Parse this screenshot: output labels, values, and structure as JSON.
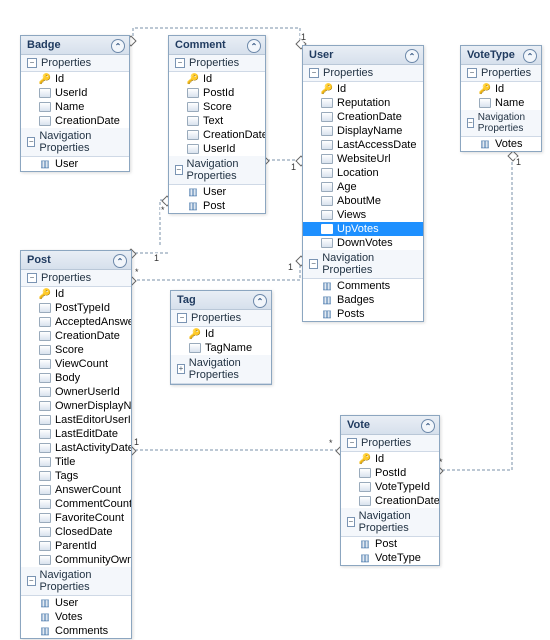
{
  "entities": {
    "badge": {
      "title": "Badge",
      "properties": [
        "Id",
        "UserId",
        "Name",
        "CreationDate"
      ],
      "keys": [
        "Id"
      ],
      "nav": [
        "User"
      ]
    },
    "comment": {
      "title": "Comment",
      "properties": [
        "Id",
        "PostId",
        "Score",
        "Text",
        "CreationDate",
        "UserId"
      ],
      "keys": [
        "Id"
      ],
      "nav": [
        "User",
        "Post"
      ]
    },
    "user": {
      "title": "User",
      "properties": [
        "Id",
        "Reputation",
        "CreationDate",
        "DisplayName",
        "LastAccessDate",
        "WebsiteUrl",
        "Location",
        "Age",
        "AboutMe",
        "Views",
        "UpVotes",
        "DownVotes"
      ],
      "keys": [
        "Id"
      ],
      "selected": "UpVotes",
      "nav": [
        "Comments",
        "Badges",
        "Posts"
      ]
    },
    "votetype": {
      "title": "VoteType",
      "properties": [
        "Id",
        "Name"
      ],
      "keys": [
        "Id"
      ],
      "nav": [
        "Votes"
      ]
    },
    "post": {
      "title": "Post",
      "properties": [
        "Id",
        "PostTypeId",
        "AcceptedAnswe...",
        "CreationDate",
        "Score",
        "ViewCount",
        "Body",
        "OwnerUserId",
        "OwnerDisplayN...",
        "LastEditorUserId",
        "LastEditDate",
        "LastActivityDate",
        "Title",
        "Tags",
        "AnswerCount",
        "CommentCount",
        "FavoriteCount",
        "ClosedDate",
        "ParentId",
        "CommunityOwn..."
      ],
      "keys": [
        "Id"
      ],
      "nav": [
        "User",
        "Votes",
        "Comments"
      ]
    },
    "tag": {
      "title": "Tag",
      "properties": [
        "Id",
        "TagName"
      ],
      "keys": [
        "Id"
      ],
      "nav": []
    },
    "vote": {
      "title": "Vote",
      "properties": [
        "Id",
        "PostId",
        "VoteTypeId",
        "CreationDate"
      ],
      "keys": [
        "Id"
      ],
      "nav": [
        "Post",
        "VoteType"
      ]
    }
  },
  "labels": {
    "properties_section": "Properties",
    "nav_section": "Navigation Properties"
  },
  "multiplicities": [
    "1",
    "*"
  ],
  "chart_data": {
    "type": "table",
    "description": "Entity-relationship diagram",
    "entities": [
      "Badge",
      "Comment",
      "User",
      "VoteType",
      "Post",
      "Tag",
      "Vote"
    ],
    "relationships": [
      {
        "from": "Badge",
        "to": "User",
        "from_mult": "*",
        "to_mult": "1"
      },
      {
        "from": "Comment",
        "to": "User",
        "from_mult": "*",
        "to_mult": "1"
      },
      {
        "from": "Comment",
        "to": "Post",
        "from_mult": "*",
        "to_mult": "1"
      },
      {
        "from": "Post",
        "to": "User",
        "from_mult": "*",
        "to_mult": "1"
      },
      {
        "from": "Vote",
        "to": "Post",
        "from_mult": "*",
        "to_mult": "1"
      },
      {
        "from": "Vote",
        "to": "VoteType",
        "from_mult": "*",
        "to_mult": "1"
      }
    ]
  }
}
